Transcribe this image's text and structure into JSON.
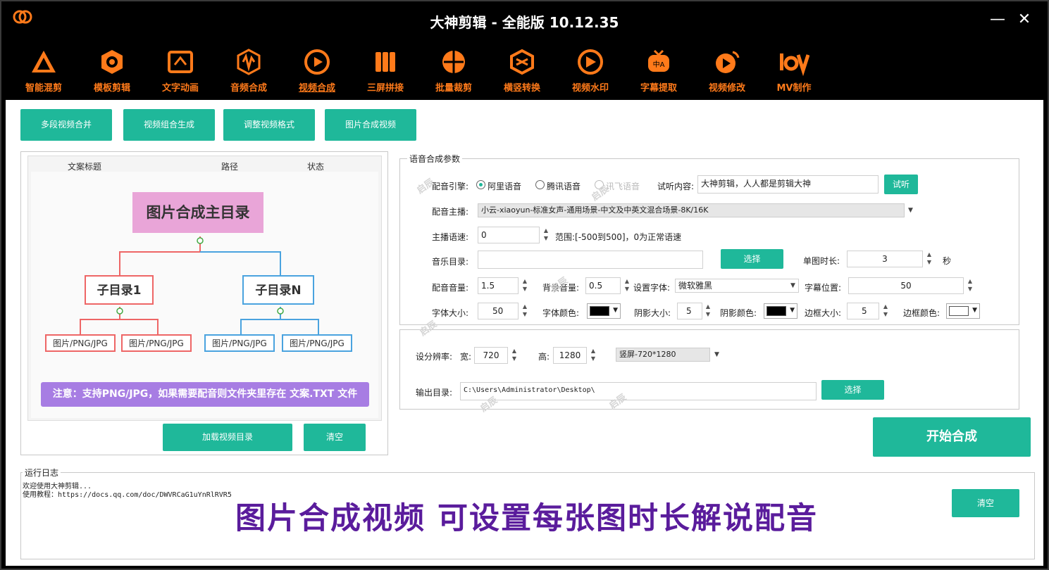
{
  "app": {
    "title": "大神剪辑 - 全能版 10.12.35",
    "minimize": "—",
    "close": "✕"
  },
  "toolbar": [
    {
      "label": "智能混剪",
      "icon": "triangle-logo-icon"
    },
    {
      "label": "模板剪辑",
      "icon": "hexagon-q-icon"
    },
    {
      "label": "文字动画",
      "icon": "text-frame-icon"
    },
    {
      "label": "音频合成",
      "icon": "audio-wave-icon"
    },
    {
      "label": "视频合成",
      "icon": "video-merge-icon"
    },
    {
      "label": "三屏拼接",
      "icon": "three-screen-icon"
    },
    {
      "label": "批量裁剪",
      "icon": "crop-ball-icon"
    },
    {
      "label": "横竖转换",
      "icon": "rotate-cube-icon"
    },
    {
      "label": "视频水印",
      "icon": "watermark-icon"
    },
    {
      "label": "字幕提取",
      "icon": "subtitle-tv-icon"
    },
    {
      "label": "视频修改",
      "icon": "video-edit-icon"
    },
    {
      "label": "MV制作",
      "icon": "mv-icon"
    }
  ],
  "subtabs": [
    "多段视频合并",
    "视频组合生成",
    "调整视频格式",
    "图片合成视频"
  ],
  "preview": {
    "headers": [
      "文案标题",
      "路径",
      "状态"
    ],
    "root": "图片合成主目录",
    "child1": "子目录1",
    "childN": "子目录N",
    "leaf": "图片/PNG/JPG",
    "note": "注意：支持PNG/JPG，如果需要配音则文件夹里存在 文案.TXT 文件"
  },
  "left_buttons": {
    "load": "加载视频目录",
    "clear": "清空"
  },
  "voice": {
    "group_title": "语音合成参数",
    "engine_label": "配音引擎:",
    "engines": [
      "阿里语音",
      "腾讯语音",
      "讯飞语音"
    ],
    "listen_label": "试听内容:",
    "listen_value": "大神剪辑，人人都是剪辑大神",
    "listen_btn": "试听",
    "anchor_label": "配音主播:",
    "anchor_value": "小云-xiaoyun-标准女声-通用场景-中文及中英文混合场景-8K/16K",
    "speed_label": "主播语速:",
    "speed_value": "0",
    "speed_hint": "范围:[-500到500]，0为正常语速",
    "music_label": "音乐目录:",
    "music_value": "",
    "choose": "选择",
    "duration_label": "单图时长:",
    "duration_value": "3",
    "duration_unit": "秒",
    "vol_label": "配音音量:",
    "vol_value": "1.5",
    "bgvol_label": "背景音量:",
    "bgvol_value": "0.5",
    "font_label": "设置字体:",
    "font_value": "微软雅黑",
    "subpos_label": "字幕位置:",
    "subpos_value": "50",
    "fontsize_label": "字体大小:",
    "fontsize_value": "50",
    "fontcolor_label": "字体颜色:",
    "shadow_label": "阴影大小:",
    "shadow_value": "5",
    "shadowcolor_label": "阴影颜色:",
    "border_label": "边框大小:",
    "border_value": "5",
    "bordercolor_label": "边框颜色:"
  },
  "output": {
    "res_label": "设分辨率:",
    "width_label": "宽:",
    "width_value": "720",
    "height_label": "高:",
    "height_value": "1280",
    "preset": "竖屏-720*1280",
    "dir_label": "输出目录:",
    "dir_value": "C:\\Users\\Administrator\\Desktop\\",
    "choose": "选择"
  },
  "start_btn": "开始合成",
  "log": {
    "title": "运行日志",
    "line1": "欢迎使用大神剪辑...",
    "line2": "使用教程：https://docs.qq.com/doc/DWVRCaG1uYnRlRVR5",
    "clear": "清空"
  },
  "overlay_caption": "图片合成视频 可设置每张图时长解说配音",
  "watermark": "启辰",
  "colors": {
    "accent": "#1fb89a",
    "orange": "#ff7a1a",
    "purple": "#5a1c9c"
  }
}
